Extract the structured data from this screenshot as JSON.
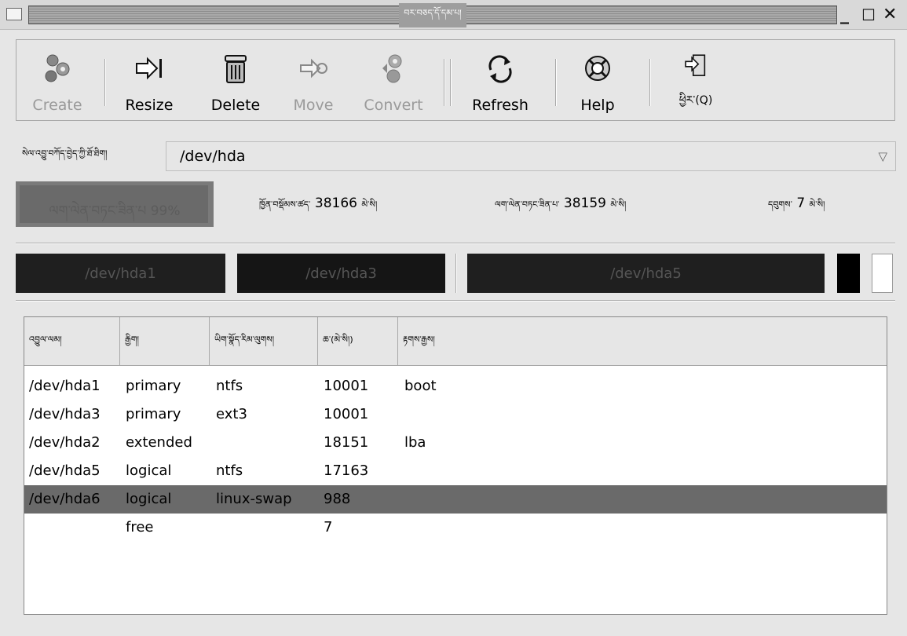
{
  "window": {
    "title": "བར་བཅད་དོ་དམ་པ།",
    "min_glyph": "_",
    "max_glyph": "☐",
    "close_glyph": "✕"
  },
  "toolbar": {
    "create": "Create",
    "resize": "Resize",
    "delete": "Delete",
    "move": "Move",
    "convert": "Convert",
    "refresh": "Refresh",
    "help": "Help",
    "quit": "ཕྱིར་(Q)"
  },
  "device": {
    "label": "སེལ་འབྱུ་བཀོད་བྱེད་ཀྱི་ཐོ་ཐིག།",
    "value": "/dev/hda",
    "arrow": "▽"
  },
  "usage": {
    "percent": 99,
    "text": "ལག་ལེན་བཏང་ཟིན་པ 99%",
    "total_label": "ཁྱོན་བསྡོམས་ཚད་",
    "total_value": "38166",
    "used_label": "ལག་ལེན་བཏང་ཟིན་པ་",
    "used_value": "38159",
    "free_label": "དབུགས་",
    "free_value": "7",
    "unit": "མེ་སི།"
  },
  "partition_map": [
    {
      "label": "/dev/hda1"
    },
    {
      "label": "/dev/hda3"
    },
    {
      "label": "/dev/hda5"
    }
  ],
  "table": {
    "headers": [
      "འབྱུལ་ལམ།",
      "རྒྱིག།",
      "ཡིག་སྣོད་རིམ་ལུགས།",
      "ཆ་(མེ་སི།)",
      "རྟགས་རྒྱས།"
    ],
    "rows": [
      {
        "device": "/dev/hda1",
        "type": "primary",
        "fs": "ntfs",
        "size": "10001",
        "flags": "boot"
      },
      {
        "device": "/dev/hda3",
        "type": "primary",
        "fs": "ext3",
        "size": "10001",
        "flags": ""
      },
      {
        "device": "/dev/hda2",
        "type": "extended",
        "fs": "",
        "size": "18151",
        "flags": "lba"
      },
      {
        "device": "/dev/hda5",
        "type": "logical",
        "fs": "ntfs",
        "size": "17163",
        "flags": ""
      },
      {
        "device": "/dev/hda6",
        "type": "logical",
        "fs": "linux-swap",
        "size": "988",
        "flags": ""
      },
      {
        "device": "",
        "type": "free",
        "fs": "",
        "size": "7",
        "flags": ""
      }
    ],
    "selected_row": 4
  },
  "colors": {
    "selected_row": "#6a6a6a",
    "partition_block": "#1f1f1f",
    "window_bg": "#e6e6e6"
  }
}
